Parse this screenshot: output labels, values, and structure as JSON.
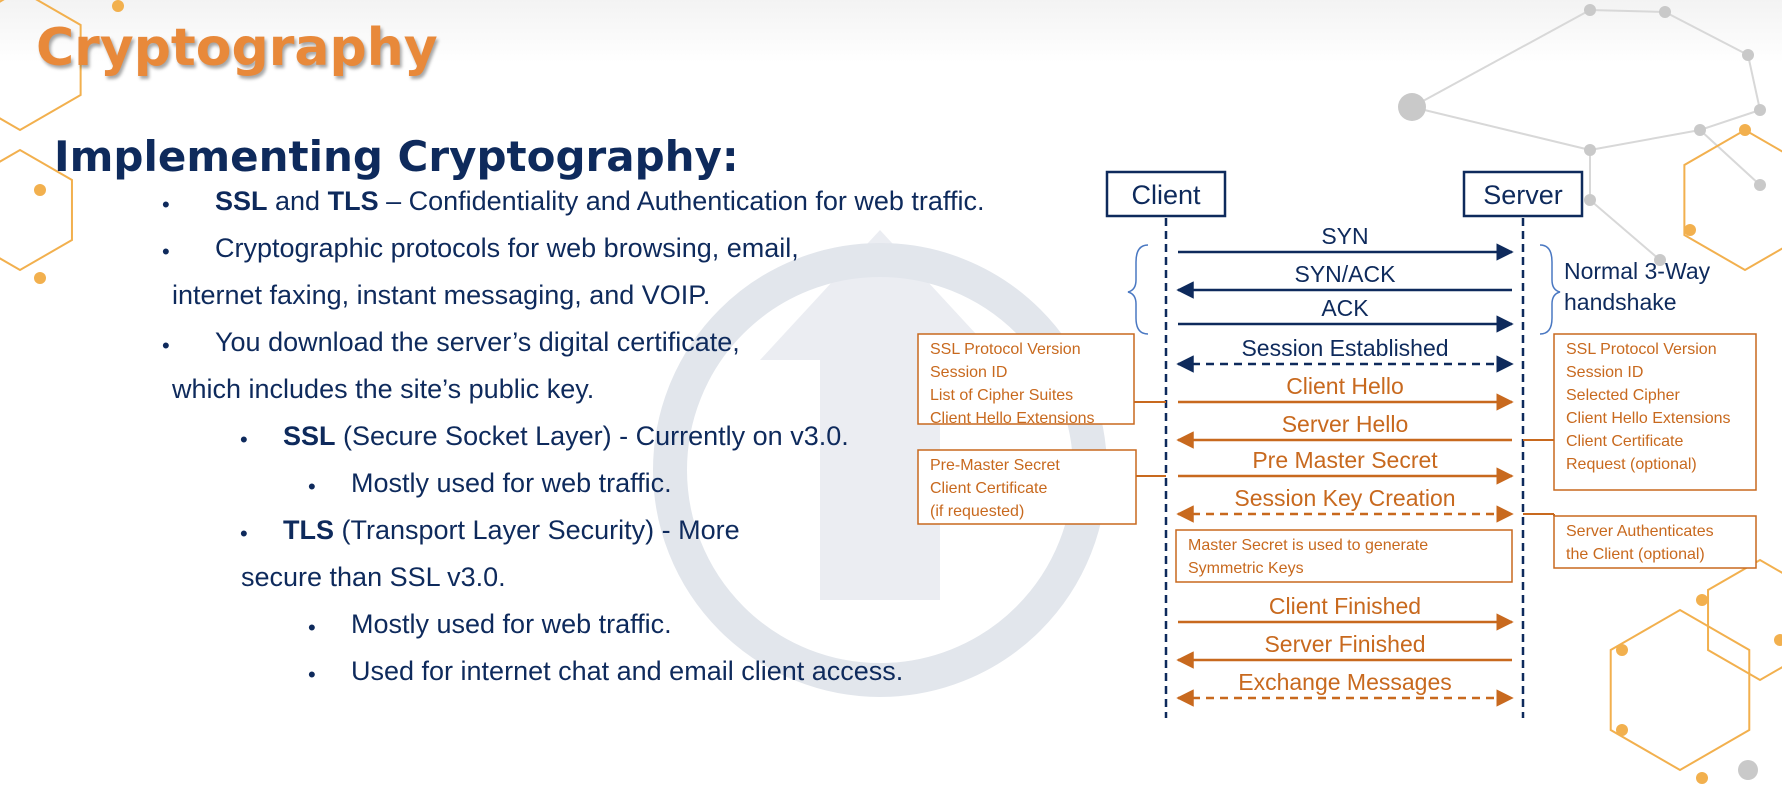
{
  "slide": {
    "title": "Cryptography",
    "heading": "Implementing Cryptography:"
  },
  "bullets": [
    {
      "level": 1,
      "lines": [
        {
          "parts": [
            {
              "t": "SSL",
              "b": true
            },
            {
              "t": " and "
            },
            {
              "t": "TLS",
              "b": true
            },
            {
              "t": " – Confidentiality and Authentication for web traffic."
            }
          ]
        }
      ]
    },
    {
      "level": 1,
      "lines": [
        {
          "parts": [
            {
              "t": "Cryptographic protocols for web browsing, email,"
            }
          ]
        },
        {
          "parts": [
            {
              "t": "internet faxing, instant messaging, and VOIP."
            }
          ]
        }
      ]
    },
    {
      "level": 1,
      "lines": [
        {
          "parts": [
            {
              "t": "You download the server’s digital certificate,"
            }
          ]
        },
        {
          "parts": [
            {
              "t": "which includes the site’s public key."
            }
          ]
        }
      ]
    },
    {
      "level": 2,
      "lines": [
        {
          "parts": [
            {
              "t": "SSL",
              "b": true
            },
            {
              "t": " (Secure Socket Layer) - Currently on v3.0."
            }
          ]
        }
      ]
    },
    {
      "level": 3,
      "lines": [
        {
          "parts": [
            {
              "t": "Mostly used for web traffic."
            }
          ]
        }
      ]
    },
    {
      "level": 2,
      "lines": [
        {
          "parts": [
            {
              "t": "TLS",
              "b": true
            },
            {
              "t": " (Transport Layer Security) - More"
            }
          ]
        },
        {
          "parts": [
            {
              "t": "secure than SSL v3.0."
            }
          ]
        }
      ]
    },
    {
      "level": 3,
      "lines": [
        {
          "parts": [
            {
              "t": "Mostly used for web traffic."
            }
          ]
        }
      ]
    },
    {
      "level": 3,
      "lines": [
        {
          "parts": [
            {
              "t": "Used for internet chat and email client access."
            }
          ]
        }
      ]
    }
  ],
  "diagram": {
    "client_label": "Client",
    "server_label": "Server",
    "handshake_note": [
      "Normal 3-Way",
      "handshake"
    ],
    "messages": [
      {
        "label": "SYN",
        "dir": "right",
        "style": "solid",
        "color": "navy"
      },
      {
        "label": "SYN/ACK",
        "dir": "left",
        "style": "solid",
        "color": "navy"
      },
      {
        "label": "ACK",
        "dir": "right",
        "style": "solid",
        "color": "navy"
      },
      {
        "label": "Session Established",
        "dir": "both",
        "style": "dashed",
        "color": "navy"
      },
      {
        "label": "Client Hello",
        "dir": "right",
        "style": "solid",
        "color": "orange"
      },
      {
        "label": "Server Hello",
        "dir": "left",
        "style": "solid",
        "color": "orange"
      },
      {
        "label": "Pre Master Secret",
        "dir": "right",
        "style": "solid",
        "color": "orange"
      },
      {
        "label": "Session Key Creation",
        "dir": "both",
        "style": "dashed",
        "color": "orange"
      },
      {
        "label": "Client Finished",
        "dir": "right",
        "style": "solid",
        "color": "orange"
      },
      {
        "label": "Server Finished",
        "dir": "left",
        "style": "solid",
        "color": "orange"
      },
      {
        "label": "Exchange Messages",
        "dir": "both",
        "style": "dashed",
        "color": "orange"
      }
    ],
    "notes": {
      "client_hello": [
        "SSL Protocol Version",
        "Session ID",
        "List of Cipher Suites",
        "Client Hello Extensions"
      ],
      "server_hello": [
        "SSL Protocol Version",
        "Session ID",
        "Selected Cipher",
        "Client Hello Extensions",
        "Client Certificate",
        "Request (optional)"
      ],
      "pre_master": [
        "Pre-Master Secret",
        "Client Certificate",
        "(if requested)"
      ],
      "master_secret": [
        "Master Secret is used to generate",
        "Symmetric Keys"
      ],
      "server_auth": [
        "Server Authenticates",
        "the Client (optional)"
      ]
    },
    "colors": {
      "navy": "#0E2A5C",
      "orange": "#C8691E",
      "accent": "#E8893A",
      "hex": "#F2B04E",
      "watermark": "#E2E6EC"
    }
  }
}
